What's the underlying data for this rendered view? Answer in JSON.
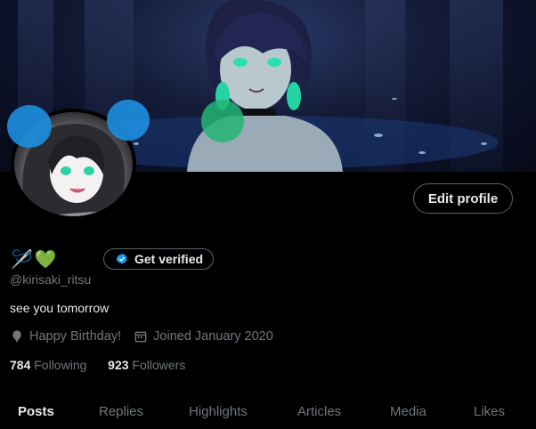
{
  "profile": {
    "name_emojis": [
      "🪡",
      "💚"
    ],
    "handle": "@kirisaki_ritsu",
    "bio": "see you tomorrow",
    "birthday": "Happy Birthday!",
    "joined": "Joined January 2020",
    "following_count": "784",
    "following_label": "Following",
    "followers_count": "923",
    "followers_label": "Followers"
  },
  "actions": {
    "edit_profile": "Edit profile",
    "get_verified": "Get verified"
  },
  "tabs": [
    {
      "label": "Posts",
      "active": true
    },
    {
      "label": "Replies",
      "active": false
    },
    {
      "label": "Highlights",
      "active": false
    },
    {
      "label": "Articles",
      "active": false
    },
    {
      "label": "Media",
      "active": false
    },
    {
      "label": "Likes",
      "active": false
    }
  ],
  "colors": {
    "background": "#000000",
    "text_primary": "#e7e9ea",
    "text_secondary": "#71767b",
    "border": "#536471",
    "verified_blue": "#1d9bf0",
    "balloon_blue": "#1d8fe0",
    "balloon_green": "#22b573"
  }
}
